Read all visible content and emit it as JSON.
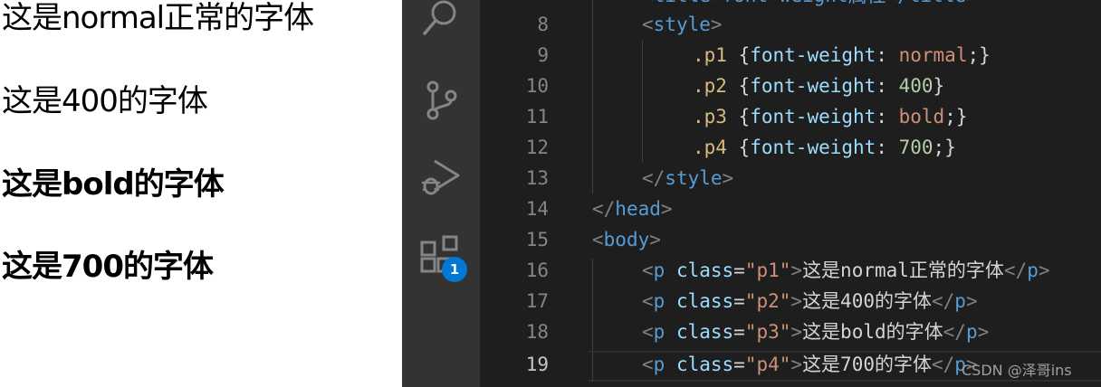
{
  "preview": {
    "lines": [
      {
        "text": "这是normal正常的字体",
        "weight": "normal"
      },
      {
        "text": "这是400的字体",
        "weight": "normal"
      },
      {
        "text": "这是bold的字体",
        "weight": "bold"
      },
      {
        "text": "这是700的字体",
        "weight": "bold"
      }
    ]
  },
  "activity_bar": {
    "icons": [
      "search-icon",
      "source-control-icon",
      "run-debug-icon",
      "extensions-icon"
    ],
    "extensions_badge": "1"
  },
  "editor": {
    "line_numbers": [
      "8",
      "9",
      "10",
      "11",
      "12",
      "13",
      "14",
      "15",
      "16",
      "17",
      "18",
      "19"
    ],
    "active_line": "19",
    "code": {
      "l8": {
        "lt": "<",
        "tag": "style",
        "gt": ">"
      },
      "l9": {
        "sel": ".p1",
        "ob": " {",
        "prop": "font-weight",
        "colon": ": ",
        "val": "normal",
        "end": ";}"
      },
      "l10": {
        "sel": ".p2",
        "ob": " {",
        "prop": "font-weight",
        "colon": ": ",
        "val": "400",
        "end": "}"
      },
      "l11": {
        "sel": ".p3",
        "ob": " {",
        "prop": "font-weight",
        "colon": ": ",
        "val": "bold",
        "end": ";}"
      },
      "l12": {
        "sel": ".p4",
        "ob": " {",
        "prop": "font-weight",
        "colon": ": ",
        "val": "700",
        "end": ";}"
      },
      "l13": {
        "lt": "</",
        "tag": "style",
        "gt": ">"
      },
      "l14": {
        "lt": "</",
        "tag": "head",
        "gt": ">"
      },
      "l15": {
        "lt": "<",
        "tag": "body",
        "gt": ">"
      },
      "l16": {
        "lt": "<",
        "tag": "p",
        "attr": " class",
        "eq": "=",
        "str": "\"p1\"",
        "gt": ">",
        "text": "这是normal正常的字体",
        "clt": "</",
        "ctag": "p",
        "cgt": ">"
      },
      "l17": {
        "lt": "<",
        "tag": "p",
        "attr": " class",
        "eq": "=",
        "str": "\"p2\"",
        "gt": ">",
        "text": "这是400的字体",
        "clt": "</",
        "ctag": "p",
        "cgt": ">"
      },
      "l18": {
        "lt": "<",
        "tag": "p",
        "attr": " class",
        "eq": "=",
        "str": "\"p3\"",
        "gt": ">",
        "text": "这是bold的字体",
        "clt": "</",
        "ctag": "p",
        "cgt": ">"
      },
      "l19": {
        "lt": "<",
        "tag": "p",
        "attr": " class",
        "eq": "=",
        "str": "\"p4\"",
        "gt": ">",
        "text": "这是700的字体",
        "clt": "</",
        "ctag": "p",
        "cgt": ">"
      }
    }
  },
  "watermark": "CSDN @泽哥ins",
  "colors": {
    "activity_bar": "#333333",
    "editor_bg": "#1e1e1e",
    "badge": "#0078d4",
    "tag": "#569cd6",
    "attribute": "#9cdcfe",
    "string": "#ce9178",
    "selector": "#d7ba7d",
    "number": "#b5cea8"
  }
}
